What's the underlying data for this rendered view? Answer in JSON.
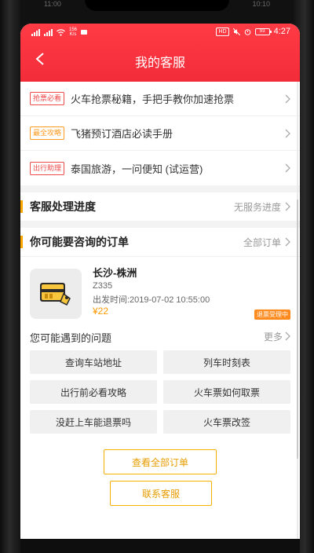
{
  "status_bar": {
    "net_speed": "156",
    "net_unit": "K/s",
    "hd": "HD",
    "battery": "93",
    "time": "4:27"
  },
  "ghost": {
    "left": "11:00",
    "right": "10:10"
  },
  "header": {
    "title": "我的客服"
  },
  "promos": [
    {
      "tag": "抢票必看",
      "text": "火车抢票秘籍，手把手教你加速抢票",
      "color": "#f04a4a"
    },
    {
      "tag": "最全攻略",
      "text": "飞猪预订酒店必读手册",
      "color": "#ff9a1f"
    },
    {
      "tag": "出行助理",
      "text": "泰国旅游，一问便知 (试运营)",
      "color": "#f04a4a"
    }
  ],
  "progress_section": {
    "title": "客服处理进度",
    "link": "无服务进度"
  },
  "orders_section": {
    "title": "你可能要咨询的订单",
    "link": "全部订单"
  },
  "order": {
    "route": "长沙-株洲",
    "train_no": "Z335",
    "depart": "出发时间:2019-07-02 10:55:00",
    "price": "¥22",
    "status": "退票受理中"
  },
  "questions": {
    "title": "您可能遇到的问题",
    "more": "更多",
    "items": [
      "查询车站地址",
      "列车时刻表",
      "出行前必看攻略",
      "火车票如何取票",
      "没赶上车能退票吗",
      "火车票改签"
    ]
  },
  "actions": {
    "view_all": "查看全部订单",
    "contact": "联系客服"
  },
  "colors": {
    "header": "#f32c3a",
    "accent": "#ffa800",
    "badge": "#ff8a1e"
  }
}
